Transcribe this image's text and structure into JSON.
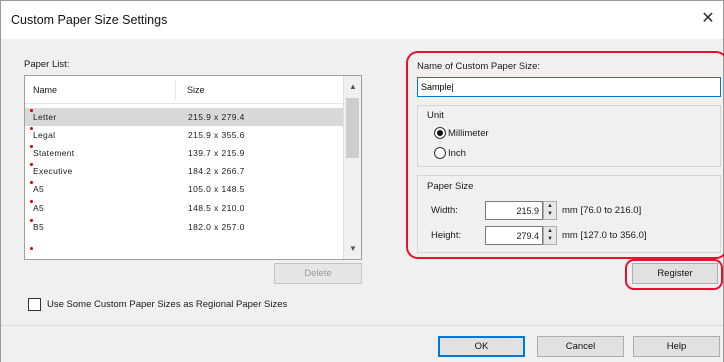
{
  "window": {
    "title": "Custom Paper Size Settings",
    "close_glyph": "✕"
  },
  "paper_list": {
    "label": "Paper List:",
    "columns": {
      "name": "Name",
      "size": "Size"
    },
    "rows": [
      {
        "name": "Letter",
        "size": "215.9 x 279.4"
      },
      {
        "name": "Legal",
        "size": "215.9 x 355.6"
      },
      {
        "name": "Statement",
        "size": "139.7 x 215.9"
      },
      {
        "name": "Executive",
        "size": "184.2 x 266.7"
      },
      {
        "name": "A5",
        "size": "105.0 x 148.5"
      },
      {
        "name": "A5",
        "size": "148.5 x 210.0"
      },
      {
        "name": "B5",
        "size": "182.0 x 257.0"
      }
    ],
    "selected_index": 0,
    "scroll_up_glyph": "▲",
    "scroll_down_glyph": "▼"
  },
  "delete_button": "Delete",
  "regional_checkbox": {
    "label": "Use Some Custom Paper Sizes as Regional Paper Sizes",
    "checked": false
  },
  "custom_name": {
    "label": "Name of Custom Paper Size:",
    "value": "Sample|"
  },
  "unit": {
    "label": "Unit",
    "options": [
      "Millimeter",
      "Inch"
    ],
    "selected": "Millimeter"
  },
  "paper_size": {
    "label": "Paper Size",
    "width": {
      "label": "Width:",
      "value": "215.9",
      "range": "mm [76.0 to 216.0]"
    },
    "height": {
      "label": "Height:",
      "value": "279.4",
      "range": "mm [127.0 to 356.0]"
    },
    "spin_up_glyph": "▲",
    "spin_down_glyph": "▼"
  },
  "register_button": "Register",
  "footer": {
    "ok": "OK",
    "cancel": "Cancel",
    "help": "Help"
  },
  "colors": {
    "highlight_outline": "#e8102e",
    "focus_blue": "#0078d7",
    "required_dot": "#d40000",
    "selected_row": "#d9d9d9"
  }
}
